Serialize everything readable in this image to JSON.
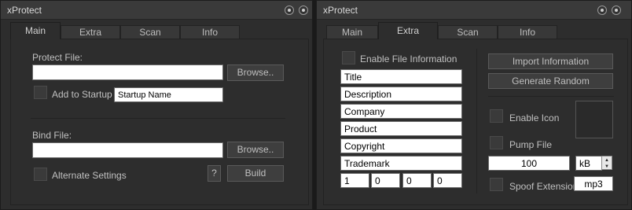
{
  "left_window": {
    "title": "xProtect",
    "tabs": [
      {
        "label": "Main",
        "active": true
      },
      {
        "label": "Extra",
        "active": false
      },
      {
        "label": "Scan",
        "active": false
      },
      {
        "label": "Info",
        "active": false
      }
    ],
    "main": {
      "protect_file_label": "Protect File:",
      "protect_file_value": "",
      "browse_label_1": "Browse..",
      "add_startup_label": "Add to Startup",
      "startup_name_value": "Startup Name",
      "bind_file_label": "Bind File:",
      "bind_file_value": "",
      "browse_label_2": "Browse..",
      "alternate_settings_label": "Alternate Settings",
      "help_label": "?",
      "build_label": "Build"
    }
  },
  "right_window": {
    "title": "xProtect",
    "tabs": [
      {
        "label": "Main",
        "active": false
      },
      {
        "label": "Extra",
        "active": true
      },
      {
        "label": "Scan",
        "active": false
      },
      {
        "label": "Info",
        "active": false
      }
    ],
    "extra": {
      "enable_file_info_label": "Enable File Information",
      "fields": {
        "title": "Title",
        "description": "Description",
        "company": "Company",
        "product": "Product",
        "copyright": "Copyright",
        "trademark": "Trademark"
      },
      "version": [
        "1",
        "0",
        "0",
        "0"
      ],
      "import_info_label": "Import Information",
      "generate_random_label": "Generate Random",
      "enable_icon_label": "Enable Icon",
      "pump_file_label": "Pump File",
      "pump_size_value": "100",
      "pump_unit_value": "kB",
      "spoof_extension_label": "Spoof Extension",
      "spoof_extension_value": "mp3"
    }
  },
  "icons": {
    "window_button": "circle-dot-icon",
    "spinner_up": "arrow-up-icon",
    "spinner_down": "arrow-down-icon"
  }
}
